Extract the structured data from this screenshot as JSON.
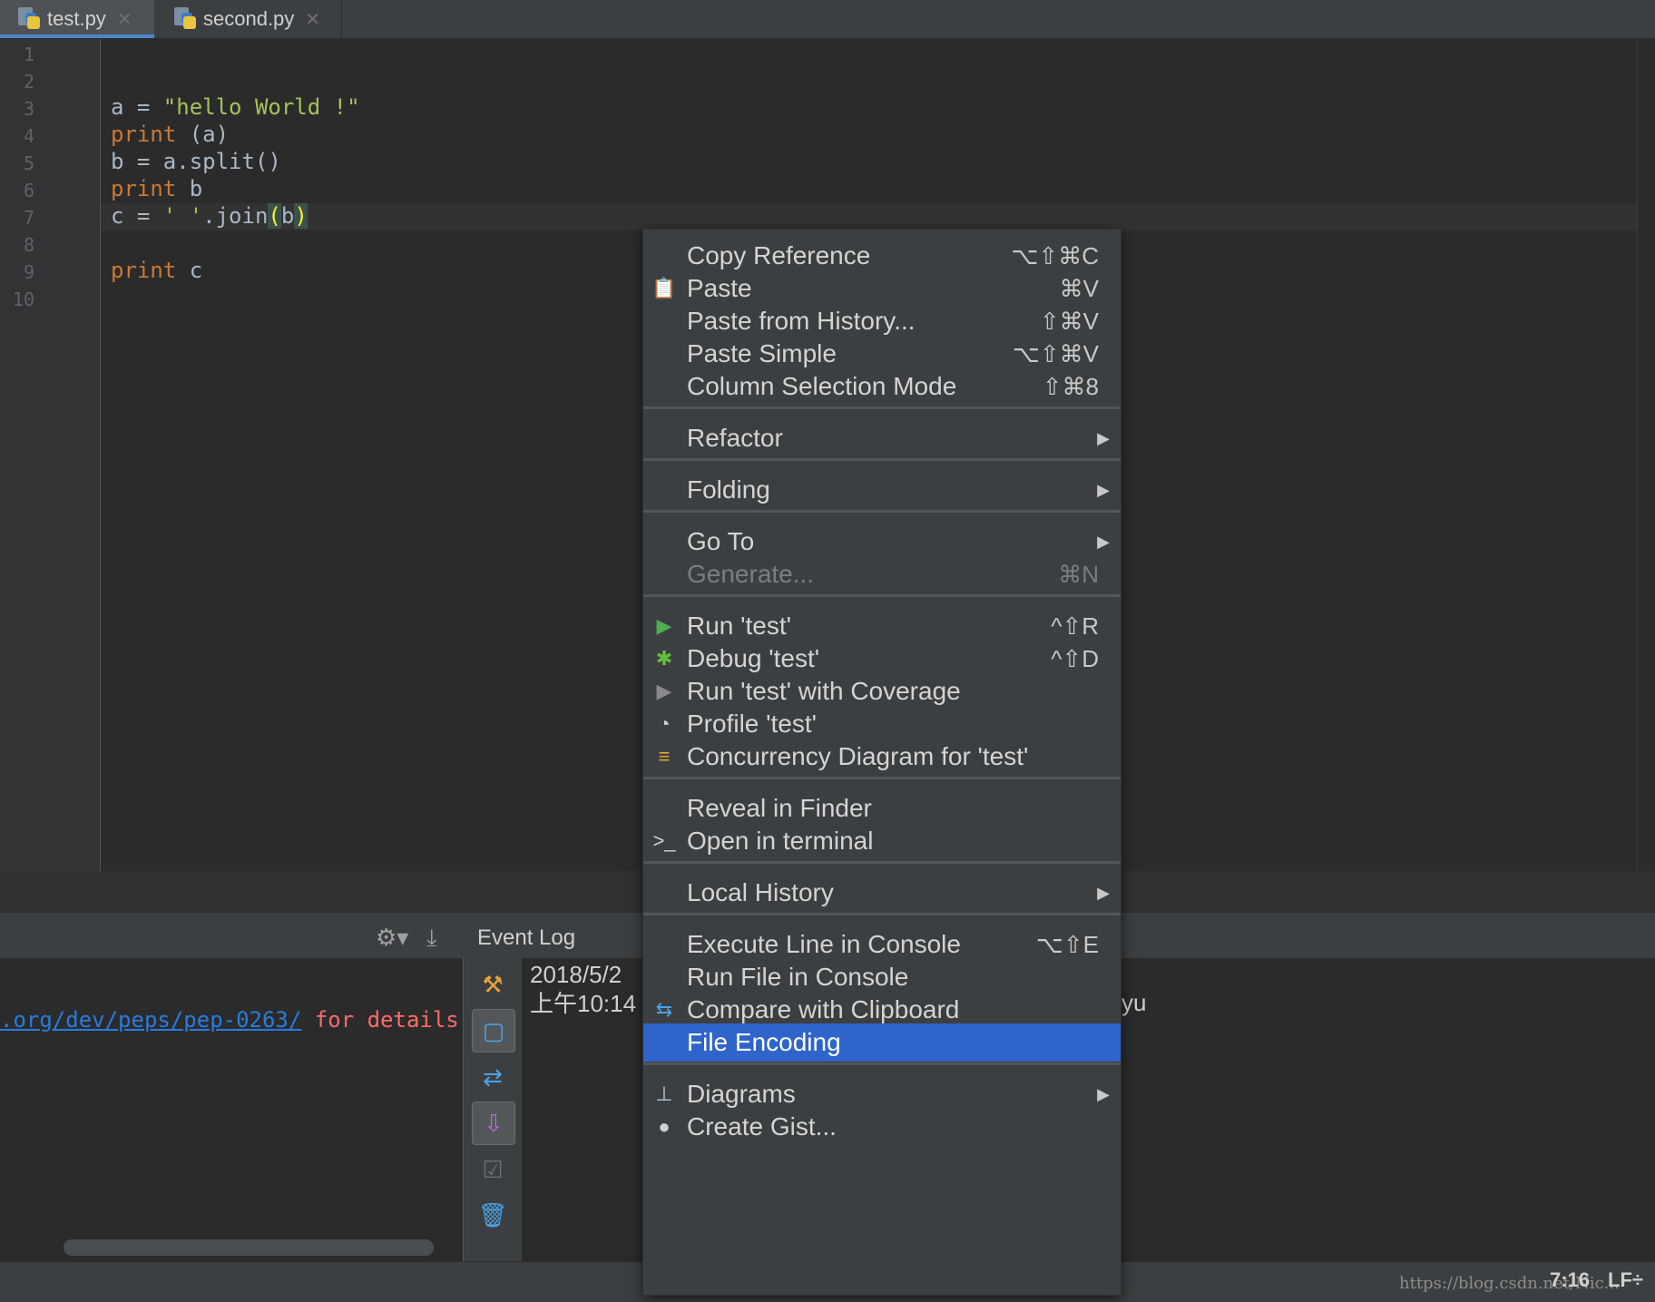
{
  "tabs": [
    {
      "label": "test.py",
      "active": true
    },
    {
      "label": "second.py",
      "active": false
    }
  ],
  "editor": {
    "line_numbers": [
      "1",
      "2",
      "3",
      "4",
      "5",
      "6",
      "7",
      "8",
      "9",
      "10"
    ],
    "current_line": 7
  },
  "event_log": {
    "title": "Event Log",
    "left_link": ".org/dev/peps/pep-0263/",
    "left_suffix": " for details",
    "date": "2018/5/2",
    "time": "上午10:14",
    "message_tail": "yu"
  },
  "status": {
    "position": "7:16",
    "line_sep": "LF÷"
  },
  "watermark": "https://blog.csdn.net/Nic...",
  "menu": {
    "items": [
      {
        "label": "Copy Reference",
        "shortcut": "⌥⇧⌘C",
        "icon": ""
      },
      {
        "label": "Paste",
        "shortcut": "⌘V",
        "icon": "paste-icon"
      },
      {
        "label": "Paste from History...",
        "shortcut": "⇧⌘V",
        "icon": ""
      },
      {
        "label": "Paste Simple",
        "shortcut": "⌥⇧⌘V",
        "icon": ""
      },
      {
        "label": "Column Selection Mode",
        "shortcut": "⇧⌘8",
        "icon": ""
      },
      {
        "label": "Refactor",
        "submenu": true
      },
      {
        "label": "Folding",
        "submenu": true
      },
      {
        "label": "Go To",
        "submenu": true
      },
      {
        "label": "Generate...",
        "shortcut": "⌘N",
        "disabled": true
      },
      {
        "label": "Run 'test'",
        "shortcut": "^⇧R",
        "icon": "run-icon"
      },
      {
        "label": "Debug 'test'",
        "shortcut": "^⇧D",
        "icon": "debug-icon"
      },
      {
        "label": "Run 'test' with Coverage",
        "icon": "coverage-icon"
      },
      {
        "label": "Profile 'test'",
        "icon": "profile-icon"
      },
      {
        "label": "Concurrency Diagram for 'test'",
        "icon": "concurrency-icon"
      },
      {
        "label": "Reveal in Finder"
      },
      {
        "label": "Open in terminal",
        "icon": "terminal-icon"
      },
      {
        "label": "Local History",
        "submenu": true
      },
      {
        "label": "Execute Line in Console",
        "shortcut": "⌥⇧E"
      },
      {
        "label": "Run File in Console"
      },
      {
        "label": "Compare with Clipboard",
        "icon": "compare-icon"
      },
      {
        "label": "File Encoding",
        "selected": true
      },
      {
        "label": "Diagrams",
        "submenu": true,
        "icon": "diagram-icon"
      },
      {
        "label": "Create Gist...",
        "icon": "github-icon"
      }
    ]
  },
  "colors": {
    "keyword": "#cc7832",
    "string": "#6a8759",
    "selection": "#2f65ca",
    "background": "#2b2b2b"
  }
}
